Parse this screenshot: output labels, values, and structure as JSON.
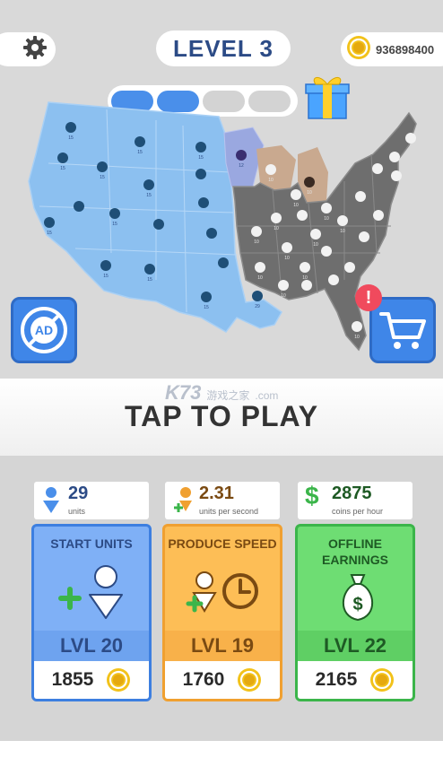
{
  "header": {
    "level_label": "LEVEL 3",
    "coins": "936898400",
    "progress_total": 4,
    "progress_done": 2
  },
  "map": {
    "state_labels": {
      "blue": "15",
      "purple": "12",
      "gray": "10",
      "tan": "10",
      "blue_big": "29"
    }
  },
  "buttons": {
    "ad_label": "AD",
    "alert_symbol": "!",
    "tap_to_play": "TAP TO PLAY"
  },
  "watermark": {
    "text": "K73",
    "sub": "游戏之家",
    "domain": ".com"
  },
  "stats": [
    {
      "value": "29",
      "label": "units"
    },
    {
      "value": "2.31",
      "label": "units per second"
    },
    {
      "value": "2875",
      "label": "coins per hour",
      "symbol": "$"
    }
  ],
  "upgrades": [
    {
      "title": "START UNITS",
      "level": "LVL 20",
      "cost": "1855"
    },
    {
      "title": "PRODUCE SPEED",
      "level": "LVL 19",
      "cost": "1760"
    },
    {
      "title": "OFFLINE EARNINGS",
      "level": "LVL 22",
      "cost": "2165"
    }
  ],
  "colors": {
    "player_blue": "#8cc0f0",
    "enemy_gray": "#6e6e6e",
    "enemy_purple": "#9aa8e0",
    "enemy_tan": "#c9a98f",
    "accent_blue": "#3f86e8",
    "coin_gold": "#f2c21a"
  }
}
